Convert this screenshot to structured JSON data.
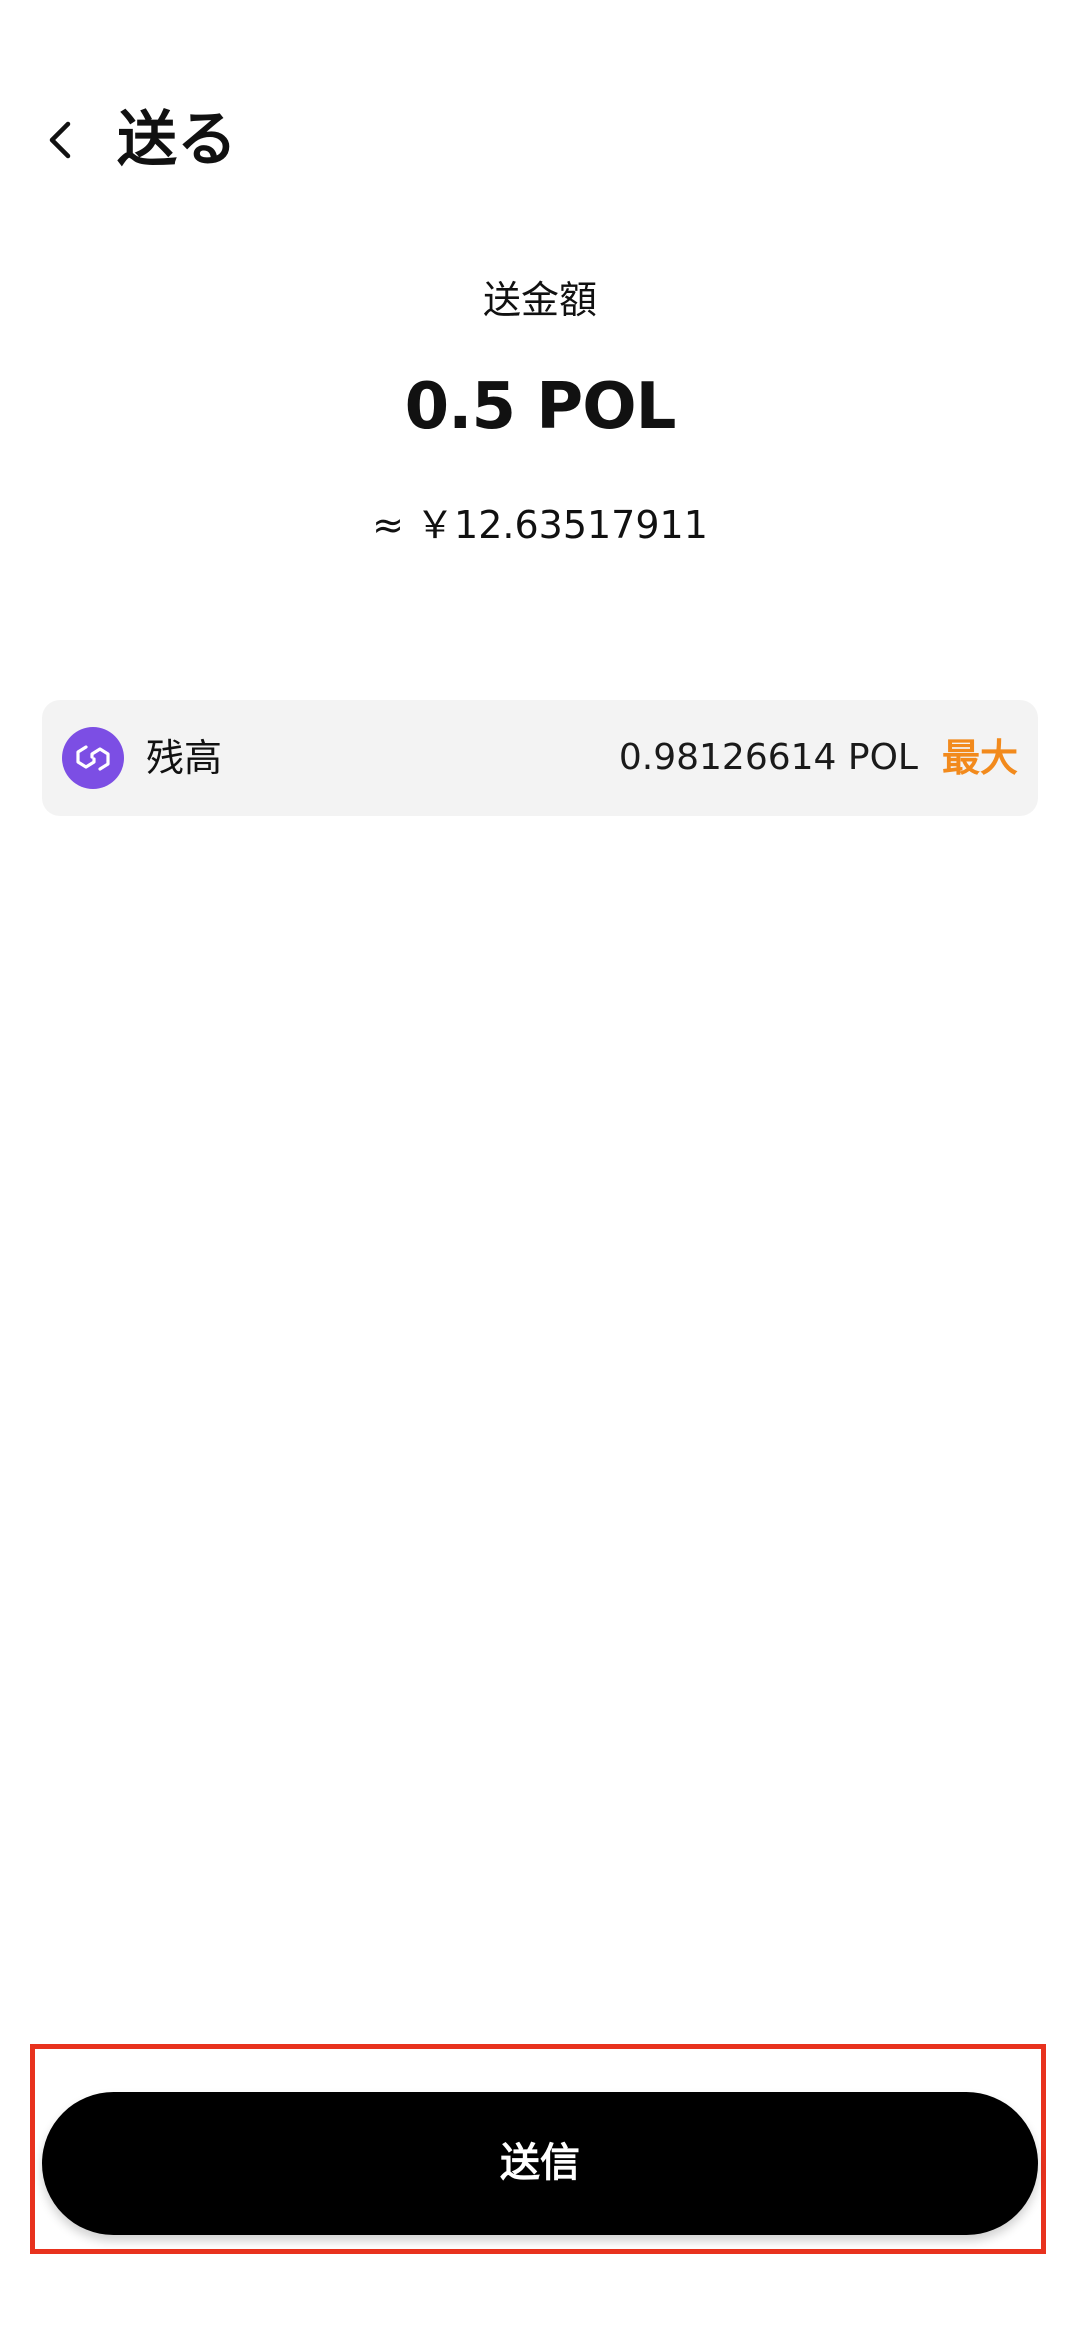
{
  "header": {
    "title": "送る",
    "back_icon": "chevron-left-icon"
  },
  "amount": {
    "label": "送金額",
    "value": "0.5 POL",
    "fiat": "≈ ￥12.63517911"
  },
  "balance": {
    "token_icon": "polygon-icon",
    "label": "残高",
    "amount": "0.98126614 POL",
    "max_label": "最大",
    "max_color": "#f28a1c",
    "token_color": "#7c4ee4"
  },
  "footer": {
    "send_label": "送信",
    "highlight_color": "#e8321e"
  }
}
